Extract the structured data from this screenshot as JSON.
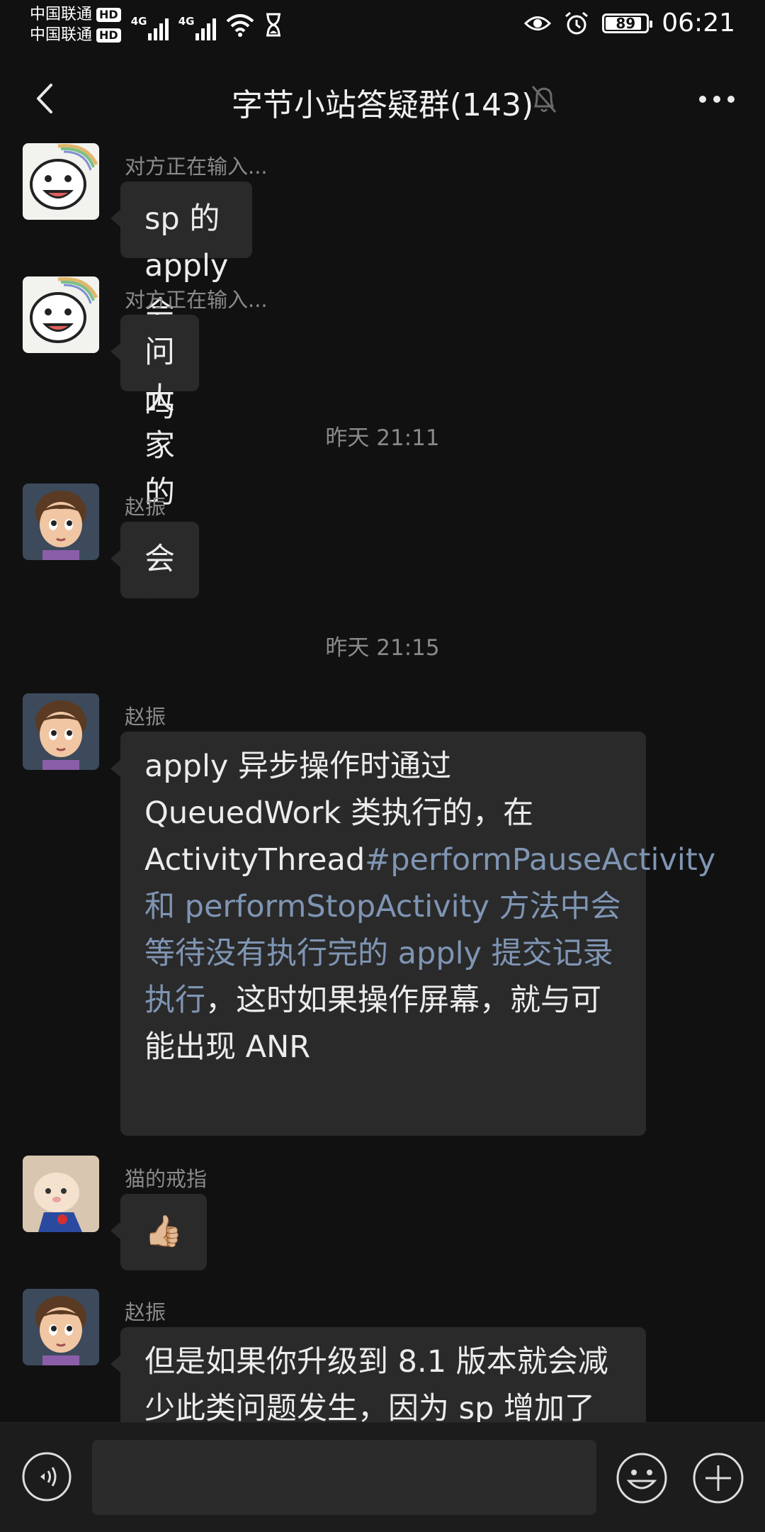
{
  "status_bar": {
    "carrier_1": "中国联通",
    "carrier_2": "中国联通",
    "hd_badge": "HD",
    "network_1": "4G",
    "network_2": "4G",
    "battery_level": "89",
    "time": "06:21"
  },
  "header": {
    "title": "字节小站答疑群(143)"
  },
  "messages": [
    {
      "sender": "对方正在输入...",
      "text": "sp 的 apply 会 anr 吗"
    },
    {
      "sender": "对方正在输入...",
      "text": "问大家的问题"
    },
    {
      "timestamp": "昨天 21:11"
    },
    {
      "sender": "赵振",
      "text": "会"
    },
    {
      "timestamp": "昨天 21:15"
    },
    {
      "sender": "赵振",
      "text_parts": {
        "plain_1": "apply 异步操作时通过 QueuedWork 类执行的，在 ActivityThread",
        "link": "#performPauseActivity 和 performStopActivity 方法中会等待没有执行完的 apply 提交记录执行",
        "plain_2": "，这时如果操作屏幕，就与可能出现 ANR"
      }
    },
    {
      "sender": "猫的戒指",
      "text": "👍🏼"
    },
    {
      "sender": "赵振",
      "text": "但是如果你升级到 8.1 版本就会减少此类问题发生，因为 sp 增加了"
    }
  ],
  "icons": {
    "back": "chevron-left-icon",
    "mute": "bell-off-icon",
    "more": "more-dots-icon",
    "voice": "voice-icon",
    "emoji": "emoji-icon",
    "plus": "plus-icon"
  },
  "colors": {
    "background": "#111111",
    "bubble": "#2a2a2a",
    "link": "#7f95b4",
    "meta_text": "#8a8a8a"
  }
}
